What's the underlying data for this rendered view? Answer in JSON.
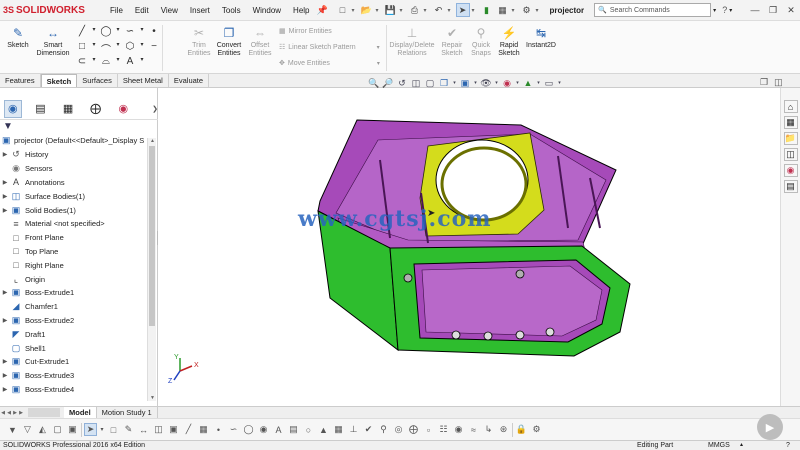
{
  "app": {
    "brand_prefix": "3S",
    "brand": "SOLIDWORKS",
    "document": "projector"
  },
  "menu": [
    "File",
    "Edit",
    "View",
    "Insert",
    "Tools",
    "Window",
    "Help"
  ],
  "search": {
    "placeholder": "Search Commands"
  },
  "command_manager": {
    "sketch": "Sketch",
    "smart_dimension_1": "Smart",
    "smart_dimension_2": "Dimension",
    "trim_1": "Trim",
    "trim_2": "Entities",
    "convert_1": "Convert",
    "convert_2": "Entities",
    "offset_1": "Offset",
    "offset_2": "Entities",
    "mirror": "Mirror Entities",
    "linear_pattern": "Linear Sketch Pattern",
    "move": "Move Entities",
    "display_delete_1": "Display/Delete",
    "display_delete_2": "Relations",
    "repair_1": "Repair",
    "repair_2": "Sketch",
    "quick_snaps_1": "Quick",
    "quick_snaps_2": "Snaps",
    "rapid_1": "Rapid",
    "rapid_2": "Sketch",
    "instant2d": "Instant2D"
  },
  "tabs": [
    "Features",
    "Sketch",
    "Surfaces",
    "Sheet Metal",
    "Evaluate"
  ],
  "active_tab": "Sketch",
  "feature_tree": {
    "root": "projector  (Default<<Default>_Display S",
    "items": [
      {
        "label": "History",
        "expandable": true,
        "icon": "history-icon"
      },
      {
        "label": "Sensors",
        "expandable": false,
        "icon": "sensor-icon"
      },
      {
        "label": "Annotations",
        "expandable": true,
        "icon": "annotation-icon"
      },
      {
        "label": "Surface Bodies(1)",
        "expandable": true,
        "icon": "surface-bodies-icon"
      },
      {
        "label": "Solid Bodies(1)",
        "expandable": true,
        "icon": "solid-bodies-icon"
      },
      {
        "label": "Material <not specified>",
        "expandable": false,
        "icon": "material-icon"
      },
      {
        "label": "Front Plane",
        "expandable": false,
        "icon": "plane-icon"
      },
      {
        "label": "Top Plane",
        "expandable": false,
        "icon": "plane-icon"
      },
      {
        "label": "Right Plane",
        "expandable": false,
        "icon": "plane-icon"
      },
      {
        "label": "Origin",
        "expandable": false,
        "icon": "origin-icon"
      },
      {
        "label": "Boss-Extrude1",
        "expandable": true,
        "icon": "extrude-icon"
      },
      {
        "label": "Chamfer1",
        "expandable": false,
        "icon": "chamfer-icon"
      },
      {
        "label": "Boss-Extrude2",
        "expandable": true,
        "icon": "extrude-icon"
      },
      {
        "label": "Draft1",
        "expandable": false,
        "icon": "draft-icon"
      },
      {
        "label": "Shell1",
        "expandable": false,
        "icon": "shell-icon"
      },
      {
        "label": "Cut-Extrude1",
        "expandable": true,
        "icon": "cut-extrude-icon"
      },
      {
        "label": "Boss-Extrude3",
        "expandable": true,
        "icon": "extrude-icon"
      },
      {
        "label": "Boss-Extrude4",
        "expandable": true,
        "icon": "extrude-icon"
      }
    ]
  },
  "viewport": {
    "watermark": "www.cgtsj.com",
    "colors": {
      "purple": "#a64ab9",
      "green": "#2ebd2e",
      "yellow": "#d4dc1c"
    },
    "triad": {
      "x": "X",
      "y": "Y",
      "z": "Z"
    }
  },
  "model_tabs": [
    "Model",
    "Motion Study 1"
  ],
  "active_model_tab": "Model",
  "status": {
    "left": "SOLIDWORKS Professional 2016 x64 Edition",
    "mode": "Editing Part",
    "units": "MMGS"
  }
}
